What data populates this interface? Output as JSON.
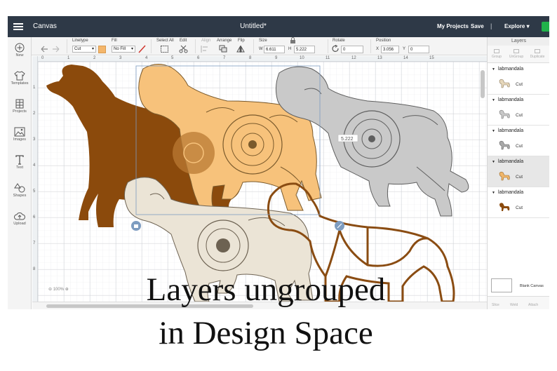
{
  "topbar": {
    "app_title": "Canvas",
    "doc_title": "Untitled*",
    "my_projects": "My Projects",
    "save": "Save",
    "separator": "|",
    "explore": "Explore",
    "colors": {
      "bar": "#2e3947",
      "make": "#21b24b"
    }
  },
  "toolbar": {
    "linetype_label": "Linetype",
    "linetype_value": "Cut",
    "fill_label": "Fill",
    "fill_value": "No Fill",
    "select_all_label": "Select All",
    "edit_label": "Edit",
    "align_label": "Align",
    "arrange_label": "Arrange",
    "flip_label": "Flip",
    "size_label": "Size",
    "w_label": "W",
    "w_value": "6.611",
    "h_label": "H",
    "h_value": "5.222",
    "rotate_label": "Rotate",
    "rotate_value": "0",
    "position_label": "Position",
    "x_label": "X",
    "x_value": "3.056",
    "y_label": "Y",
    "y_value": "0",
    "fill_swatch": "#f4b66b"
  },
  "leftbar": {
    "items": [
      {
        "label": "New",
        "icon": "plus-circle-icon"
      },
      {
        "label": "Templates",
        "icon": "shirt-icon"
      },
      {
        "label": "Projects",
        "icon": "projects-icon"
      },
      {
        "label": "Images",
        "icon": "image-icon"
      },
      {
        "label": "Text",
        "icon": "text-icon"
      },
      {
        "label": "Shapes",
        "icon": "shapes-icon"
      },
      {
        "label": "Upload",
        "icon": "upload-cloud-icon"
      }
    ]
  },
  "canvas": {
    "ruler_top": [
      "0",
      "1",
      "2",
      "3",
      "4",
      "5",
      "6",
      "7",
      "8",
      "9",
      "10",
      "11",
      "12",
      "13",
      "14",
      "15"
    ],
    "ruler_left": [
      "1",
      "2",
      "3",
      "4",
      "5",
      "6",
      "7",
      "8"
    ],
    "size_tooltip": "5.222",
    "zoom": "100%",
    "dog_colors": [
      "#8b4a0c",
      "#f6c17a",
      "#bfbfbf",
      "#e9e1d3",
      "#8a4c12"
    ]
  },
  "layers": {
    "title": "Layers",
    "tools": [
      "Group",
      "UnGroup",
      "Duplicate"
    ],
    "groups": [
      {
        "name": "labmandala",
        "op": "Cut",
        "color": "#e6d7bb",
        "selected": false
      },
      {
        "name": "labmandala",
        "op": "Cut",
        "color": "#c8c8c8",
        "selected": false
      },
      {
        "name": "labmandala",
        "op": "Cut",
        "color": "#a9a9a9",
        "selected": false
      },
      {
        "name": "labmandala",
        "op": "Cut",
        "color": "#f0b66a",
        "selected": true
      },
      {
        "name": "labmandala",
        "op": "Cut",
        "color": "#8b4a0c",
        "selected": false
      }
    ],
    "blank_canvas": "Blank Canvas",
    "bottom_tools": [
      "Slice",
      "Weld",
      "Attach"
    ]
  },
  "caption": {
    "line1": "Layers ungrouped",
    "line2": "in Design Space"
  }
}
